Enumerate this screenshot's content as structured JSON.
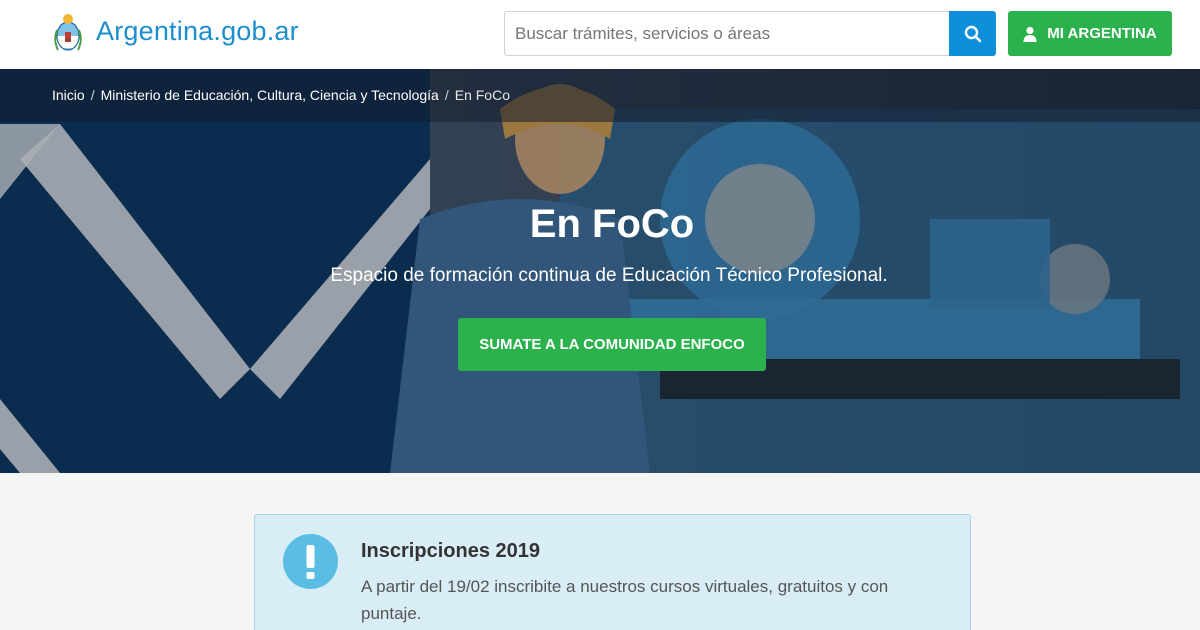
{
  "header": {
    "brand": "Argentina.gob.ar",
    "search": {
      "placeholder": "Buscar trámites, servicios o áreas",
      "icon": "search-icon"
    },
    "mi_argentina": {
      "label": "MI ARGENTINA",
      "icon": "user-icon"
    }
  },
  "breadcrumb": {
    "items": [
      "Inicio",
      "Ministerio de Educación, Cultura, Ciencia y Tecnología"
    ],
    "current": "En FoCo",
    "separator": "/"
  },
  "hero": {
    "title": "En FoCo",
    "subtitle": "Espacio de formación continua de Educación Técnico Profesional.",
    "cta_label": "SUMATE A LA COMUNIDAD ENFOCO"
  },
  "alert": {
    "icon": "exclamation-icon",
    "title": "Inscripciones 2019",
    "text": "A partir del 19/02 inscribite a nuestros cursos virtuales, gratuitos y con puntaje."
  },
  "colors": {
    "brand_blue": "#1d8ece",
    "search_blue": "#0f8fd9",
    "green": "#2bb24c",
    "alert_bg": "#d9edf7",
    "alert_icon": "#5bbde4",
    "hero_navy": "#0e3a66"
  }
}
